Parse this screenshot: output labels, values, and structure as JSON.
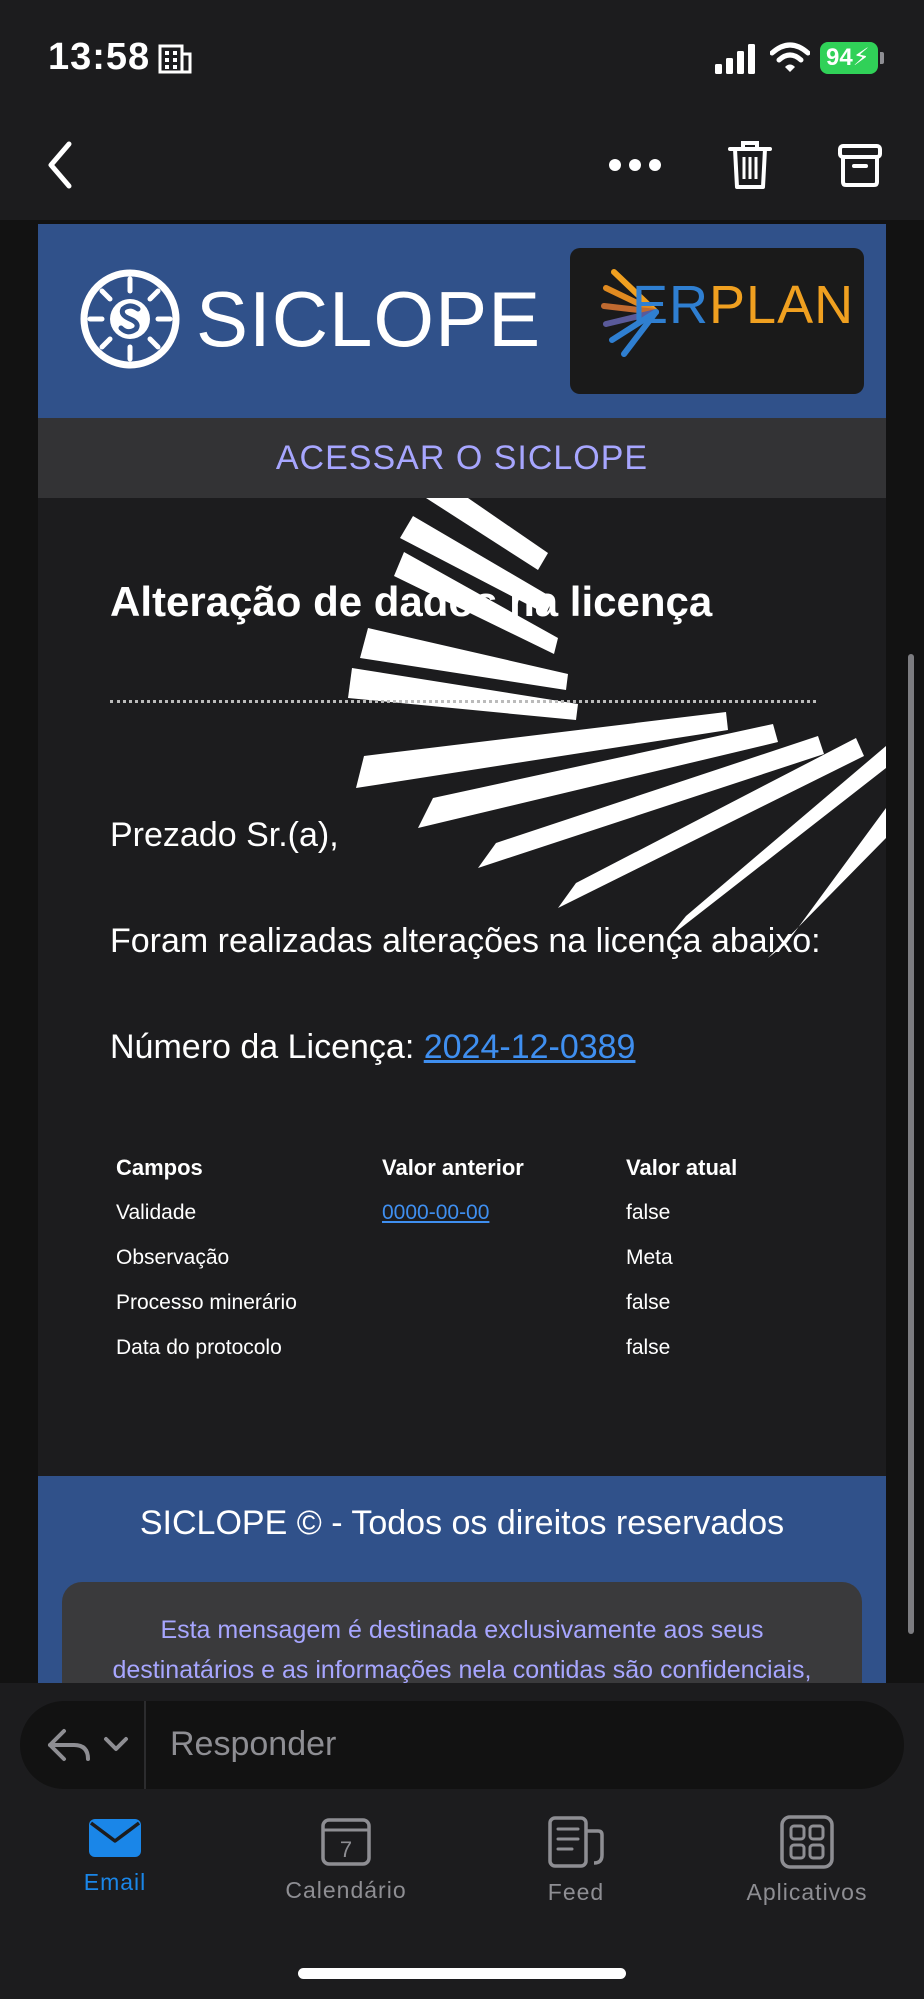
{
  "status_bar": {
    "time": "13:58",
    "battery": "94"
  },
  "nav": {
    "back_icon": "chevron-left-icon",
    "more_icon": "ellipsis-icon",
    "delete_icon": "trash-icon",
    "archive_icon": "archive-icon"
  },
  "email": {
    "brand": "SICLOPE",
    "partner_brand_part1": "ER",
    "partner_brand_part2": "PLAN",
    "access_link": "ACESSAR O SICLOPE",
    "title": "Alteração de dados na licença",
    "greeting": "Prezado Sr.(a),",
    "intro": "Foram realizadas alterações na licença abaixo:",
    "license_label": "Número da Licença:",
    "license_number": "2024-12-0389",
    "table": {
      "headers": [
        "Campos",
        "Valor anterior",
        "Valor atual"
      ],
      "rows": [
        [
          "Validade",
          "0000-00-00",
          "false"
        ],
        [
          "Observação",
          "",
          "Meta"
        ],
        [
          "Processo minerário",
          "",
          "false"
        ],
        [
          "Data do protocolo",
          "",
          "false"
        ]
      ]
    },
    "footer_title": "SICLOPE © - Todos os direitos reservados",
    "footer_notice_line1": "Esta mensagem é destinada exclusivamente aos seus",
    "footer_notice_line2": "destinatários e as informações nela contidas são confidenciais,"
  },
  "reply": {
    "placeholder": "Responder"
  },
  "tabs": [
    {
      "label": "Email",
      "icon": "envelope-icon",
      "active": true
    },
    {
      "label": "Calendário",
      "icon": "calendar-icon",
      "day": "7"
    },
    {
      "label": "Feed",
      "icon": "feed-icon"
    },
    {
      "label": "Aplicativos",
      "icon": "apps-grid-icon"
    }
  ],
  "colors": {
    "header_blue": "#30518a",
    "link_blue": "#3f8ff0",
    "lavender": "#a7a6ff",
    "battery_green": "#30d158"
  }
}
